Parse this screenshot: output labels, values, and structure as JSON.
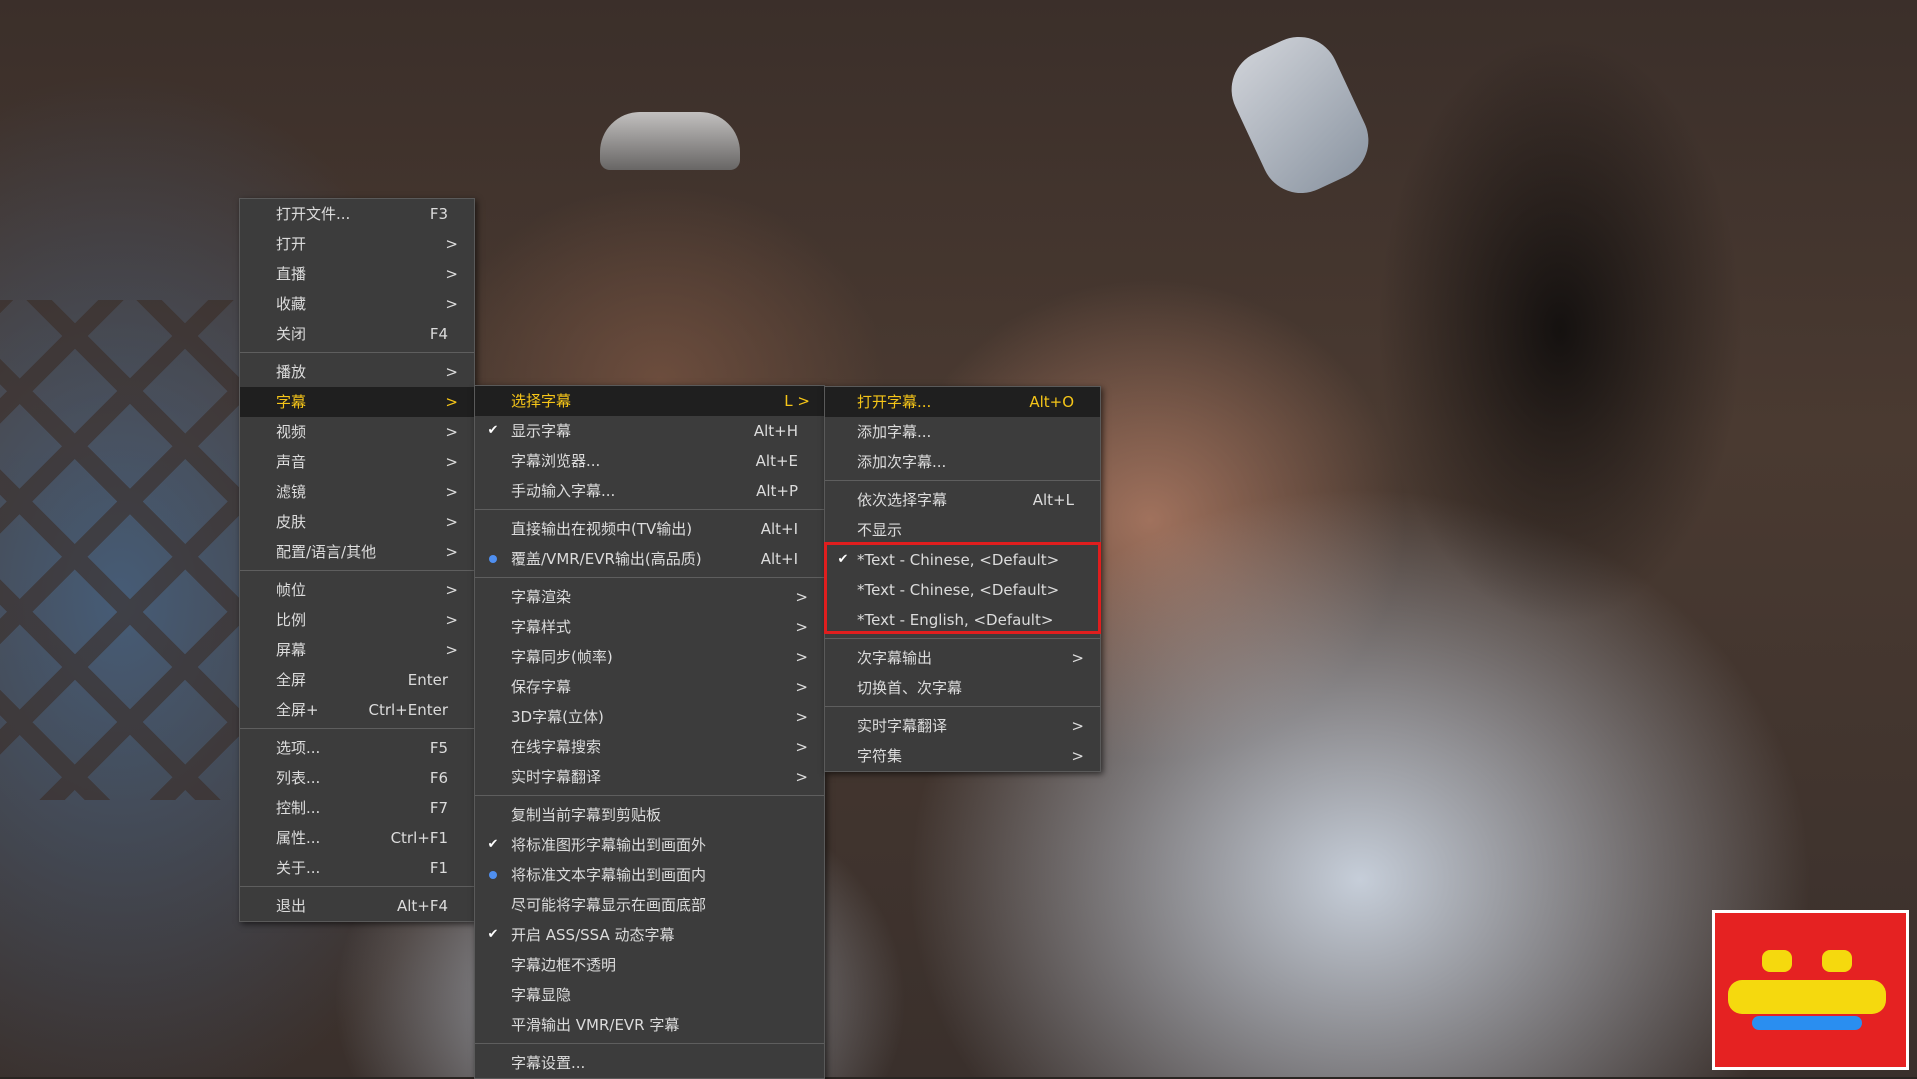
{
  "main_menu": [
    {
      "label": "打开文件...",
      "shortcut": "F3"
    },
    {
      "label": "打开",
      "arrow": ">"
    },
    {
      "label": "直播",
      "arrow": ">"
    },
    {
      "label": "收藏",
      "arrow": ">"
    },
    {
      "label": "关闭",
      "shortcut": "F4"
    },
    {
      "label": "播放",
      "arrow": ">"
    },
    {
      "label": "字幕",
      "arrow": ">"
    },
    {
      "label": "视频",
      "arrow": ">"
    },
    {
      "label": "声音",
      "arrow": ">"
    },
    {
      "label": "滤镜",
      "arrow": ">"
    },
    {
      "label": "皮肤",
      "arrow": ">"
    },
    {
      "label": "配置/语言/其他",
      "arrow": ">"
    },
    {
      "label": "帧位",
      "arrow": ">"
    },
    {
      "label": "比例",
      "arrow": ">"
    },
    {
      "label": "屏幕",
      "arrow": ">"
    },
    {
      "label": "全屏",
      "shortcut": "Enter"
    },
    {
      "label": "全屏+",
      "shortcut": "Ctrl+Enter"
    },
    {
      "label": "选项...",
      "shortcut": "F5"
    },
    {
      "label": "列表...",
      "shortcut": "F6"
    },
    {
      "label": "控制...",
      "shortcut": "F7"
    },
    {
      "label": "属性...",
      "shortcut": "Ctrl+F1"
    },
    {
      "label": "关于...",
      "shortcut": "F1"
    },
    {
      "label": "退出",
      "shortcut": "Alt+F4"
    }
  ],
  "subtitle_menu": [
    {
      "label": "选择字幕",
      "shortcut": "L >"
    },
    {
      "label": "显示字幕",
      "shortcut": "Alt+H"
    },
    {
      "label": "字幕浏览器...",
      "shortcut": "Alt+E"
    },
    {
      "label": "手动输入字幕...",
      "shortcut": "Alt+P"
    },
    {
      "label": "直接输出在视频中(TV输出)",
      "shortcut": "Alt+I"
    },
    {
      "label": "覆盖/VMR/EVR输出(高品质)",
      "shortcut": "Alt+I"
    },
    {
      "label": "字幕渲染",
      "arrow": ">"
    },
    {
      "label": "字幕样式",
      "arrow": ">"
    },
    {
      "label": "字幕同步(帧率)",
      "arrow": ">"
    },
    {
      "label": "保存字幕",
      "arrow": ">"
    },
    {
      "label": "3D字幕(立体)",
      "arrow": ">"
    },
    {
      "label": "在线字幕搜索",
      "arrow": ">"
    },
    {
      "label": "实时字幕翻译",
      "arrow": ">"
    },
    {
      "label": "复制当前字幕到剪贴板"
    },
    {
      "label": "将标准图形字幕输出到画面外"
    },
    {
      "label": "将标准文本字幕输出到画面内"
    },
    {
      "label": "尽可能将字幕显示在画面底部"
    },
    {
      "label": "开启 ASS/SSA 动态字幕"
    },
    {
      "label": "字幕边框不透明"
    },
    {
      "label": "字幕显隐"
    },
    {
      "label": "平滑输出 VMR/EVR 字幕"
    },
    {
      "label": "字幕设置..."
    }
  ],
  "select_menu": [
    {
      "label": "打开字幕...",
      "shortcut": "Alt+O"
    },
    {
      "label": "添加字幕..."
    },
    {
      "label": "添加次字幕..."
    },
    {
      "label": "依次选择字幕",
      "shortcut": "Alt+L"
    },
    {
      "label": "不显示"
    },
    {
      "label": "*Text - Chinese, <Default>"
    },
    {
      "label": "*Text - Chinese, <Default>"
    },
    {
      "label": "*Text - English, <Default>"
    },
    {
      "label": "次字幕输出",
      "arrow": ">"
    },
    {
      "label": "切换首、次字幕"
    },
    {
      "label": "实时字幕翻译",
      "arrow": ">"
    },
    {
      "label": "字符集",
      "arrow": ">"
    }
  ],
  "colors": {
    "menu_bg": "#3c3c3c",
    "active_text": "#f5c518",
    "highlight_border": "#e01e1e",
    "radio": "#4f8ff0"
  }
}
